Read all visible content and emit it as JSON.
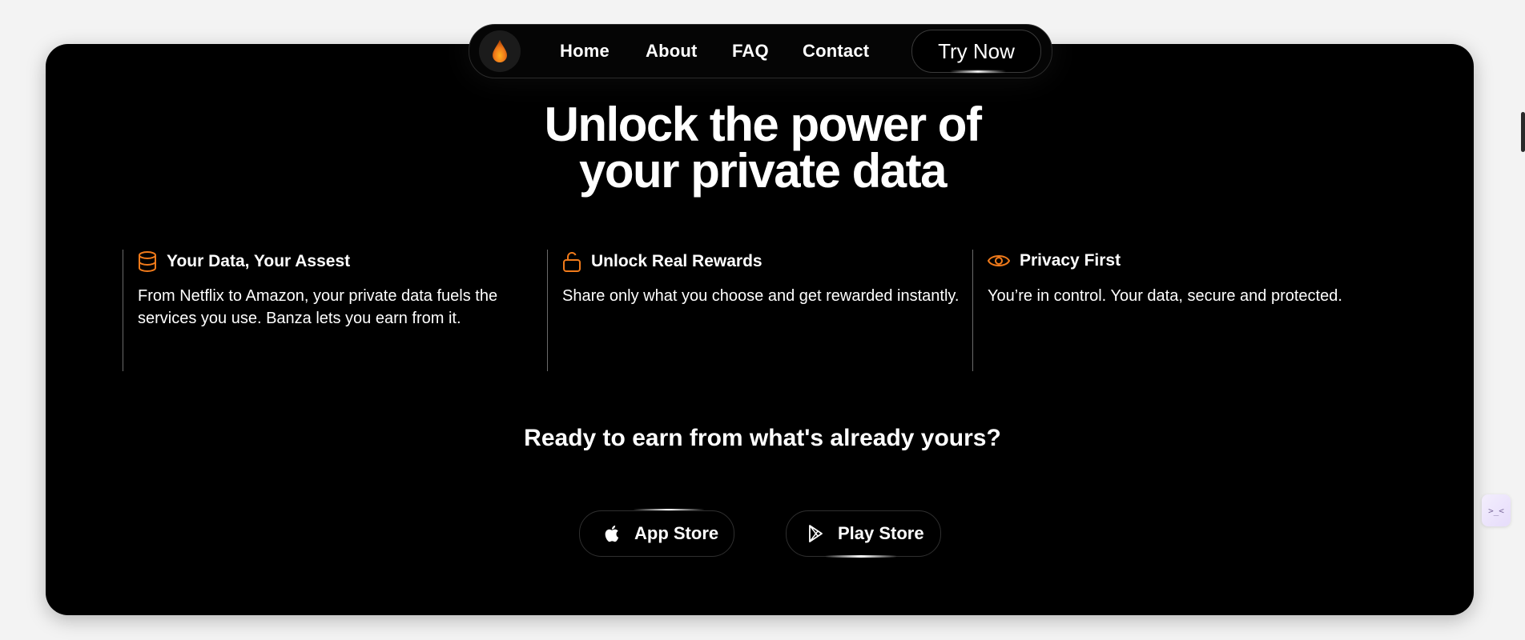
{
  "nav": {
    "links": [
      "Home",
      "About",
      "FAQ",
      "Contact"
    ],
    "cta_label": "Try Now",
    "logo_icon": "flame-drop-icon"
  },
  "hero": {
    "headline_line1": "Unlock the power of",
    "headline_line2": "your private data"
  },
  "features": [
    {
      "icon": "database-icon",
      "title": "Your Data, Your Assest",
      "description": "From Netflix to Amazon, your private data fuels the services you use. Banza lets you earn from it."
    },
    {
      "icon": "unlock-icon",
      "title": "Unlock Real Rewards",
      "description": "Share only what you choose and get rewarded instantly."
    },
    {
      "icon": "eye-icon",
      "title": "Privacy First",
      "description": "You’re in control. Your data, secure and protected."
    }
  ],
  "cta": {
    "text": "Ready to earn from what's already yours?",
    "app_store_label": "App Store",
    "play_store_label": "Play Store"
  },
  "widget": {
    "glyph": ">_<"
  },
  "colors": {
    "accent": "#f07a1a",
    "background": "#000000",
    "page": "#f3f3f3"
  }
}
